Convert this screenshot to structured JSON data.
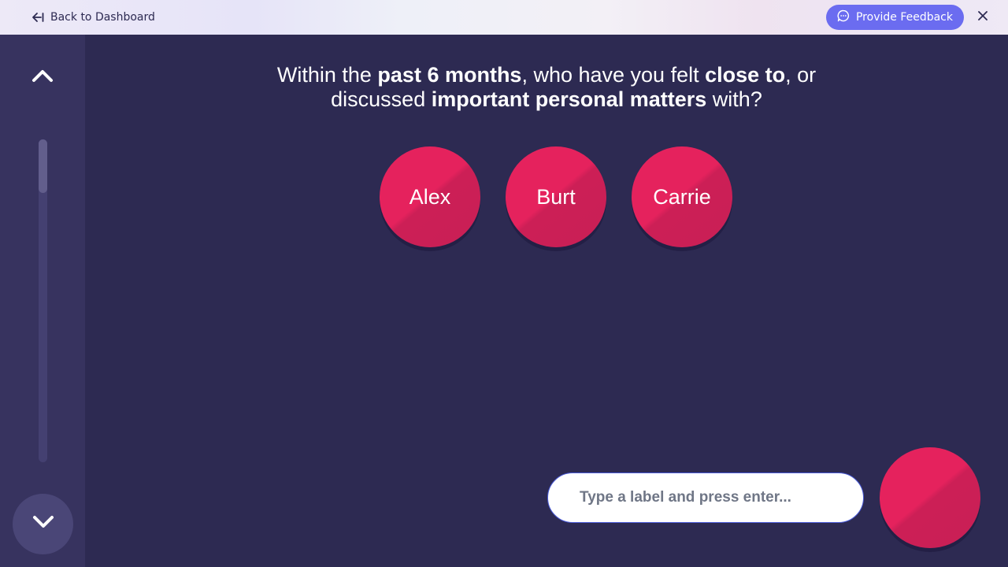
{
  "header": {
    "back_label": "Back to Dashboard",
    "feedback_label": "Provide Feedback"
  },
  "prompt": {
    "segments": [
      {
        "text": "Within the ",
        "bold": false
      },
      {
        "text": "past 6 months",
        "bold": true
      },
      {
        "text": ", who have you felt ",
        "bold": false
      },
      {
        "text": "close to",
        "bold": true
      },
      {
        "text": ", or discussed ",
        "bold": false
      },
      {
        "text": "important personal matters",
        "bold": true
      },
      {
        "text": " with?",
        "bold": false
      }
    ]
  },
  "nodes": [
    {
      "label": "Alex"
    },
    {
      "label": "Burt"
    },
    {
      "label": "Carrie"
    }
  ],
  "input": {
    "placeholder": "Type a label and press enter...",
    "value": ""
  },
  "colors": {
    "background": "#2d2a52",
    "sidebar": "#37335f",
    "node": "#e5225d",
    "accent": "#6b6cf0"
  },
  "icons": {
    "back": "arrow-left-to-line-icon",
    "feedback": "chat-bubble-icon",
    "close": "close-icon",
    "up": "chevron-up-icon",
    "down": "chevron-down-icon"
  }
}
